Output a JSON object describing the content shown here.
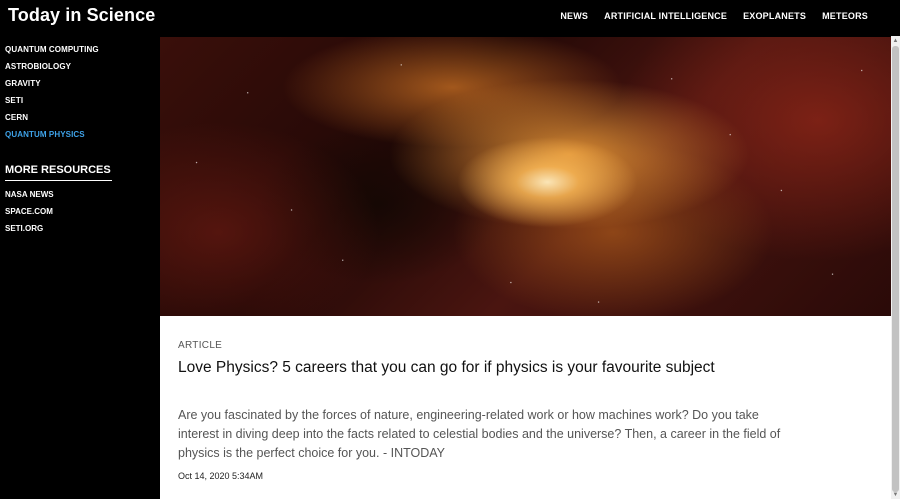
{
  "header": {
    "site_title": "Today in Science",
    "nav": [
      "NEWS",
      "ARTIFICIAL INTELLIGENCE",
      "EXOPLANETS",
      "METEORS"
    ]
  },
  "sidebar": {
    "items": [
      "QUANTUM COMPUTING",
      "ASTROBIOLOGY",
      "GRAVITY",
      "SETI",
      "CERN",
      "QUANTUM PHYSICS"
    ],
    "active_item": "QUANTUM PHYSICS",
    "more_heading": "MORE RESOURCES",
    "resources": [
      "NASA NEWS",
      "SPACE.COM",
      "SETI.ORG"
    ]
  },
  "article": {
    "type": "ARTICLE",
    "title": "Love Physics? 5 careers that you can go for if physics is your favourite subject",
    "summary": "Are you fascinated by the forces of nature, engineering-related work or how machines work? Do you take interest in diving deep into the facts related to celestial bodies and the universe? Then, a career in the field of physics is the perfect choice for you. - INTODAY",
    "date": "Oct 14, 2020 5:34AM",
    "hero_image": "nebula-image"
  },
  "scrollbar": {
    "up_glyph": "▲",
    "down_glyph": "▼"
  },
  "colors": {
    "background": "#000000",
    "accent_active": "#3ea2e8",
    "card_background": "#ffffff"
  }
}
